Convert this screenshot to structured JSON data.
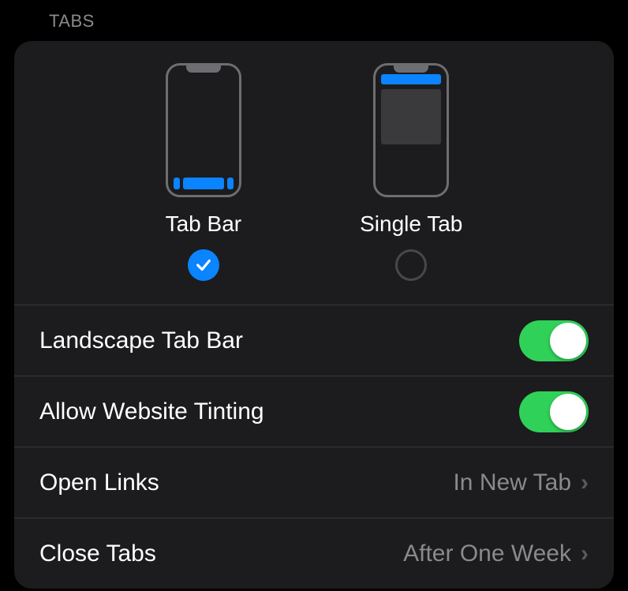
{
  "section": {
    "header": "TABS"
  },
  "layouts": {
    "tabbar": {
      "label": "Tab Bar",
      "selected": true
    },
    "singletab": {
      "label": "Single Tab",
      "selected": false
    }
  },
  "rows": {
    "landscape": {
      "label": "Landscape Tab Bar",
      "on": true
    },
    "tinting": {
      "label": "Allow Website Tinting",
      "on": true
    },
    "openlinks": {
      "label": "Open Links",
      "value": "In New Tab"
    },
    "closetabs": {
      "label": "Close Tabs",
      "value": "After One Week"
    }
  }
}
